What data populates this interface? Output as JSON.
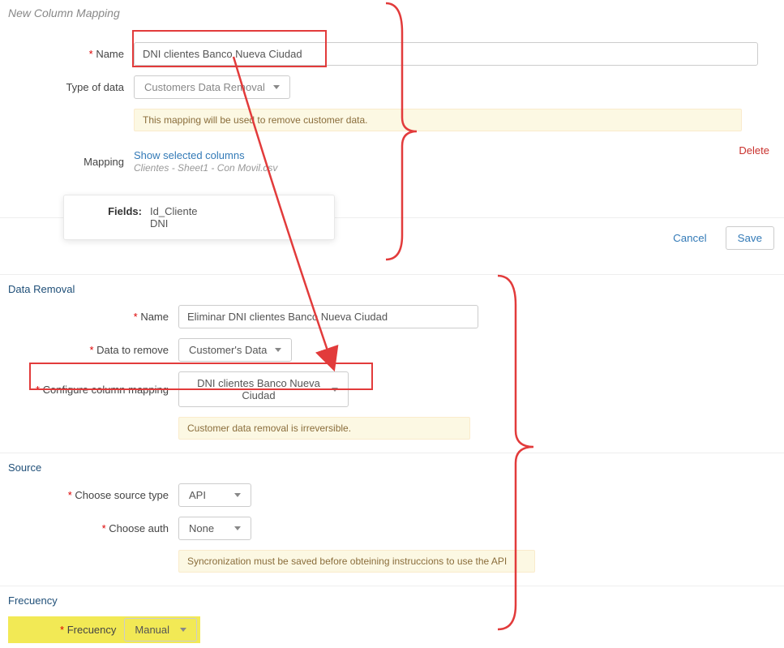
{
  "top": {
    "title": "New Column Mapping",
    "name_label": "Name",
    "name_value": "DNI clientes Banco Nueva Ciudad",
    "type_label": "Type of data",
    "type_value": "Customers Data Removal",
    "note": "This mapping will be used to remove customer data.",
    "mapping_label": "Mapping",
    "show_cols": "Show selected columns",
    "file": "Clientes - Sheet1 - Con Movil.csv",
    "delete": "Delete",
    "fields_label": "Fields:",
    "fields": [
      "Id_Cliente",
      "DNI"
    ],
    "cancel": "Cancel",
    "save": "Save"
  },
  "lower": {
    "section_data_removal": "Data Removal",
    "name_label": "Name",
    "name_value": "Eliminar DNI clientes Banco Nueva Ciudad",
    "data_remove_label": "Data to remove",
    "data_remove_value": "Customer's Data",
    "col_map_label": "Configure column mapping",
    "col_map_value": "DNI clientes Banco Nueva Ciudad",
    "note_removal": "Customer data removal is irreversible.",
    "section_source": "Source",
    "src_type_label": "Choose source type",
    "src_type_value": "API",
    "auth_label": "Choose auth",
    "auth_value": "None",
    "note_api": "Syncronization must be saved before obteining instruccions to use the API",
    "section_freq": "Frecuency",
    "freq_label": "Frecuency",
    "freq_value": "Manual"
  }
}
